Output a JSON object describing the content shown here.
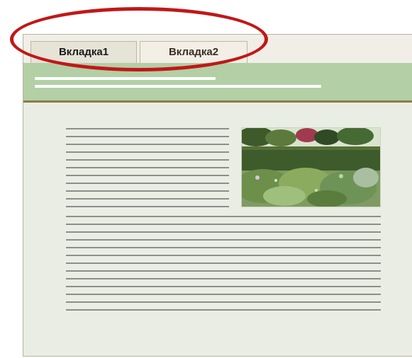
{
  "tabs": [
    {
      "label": "Вкладка1",
      "active": true
    },
    {
      "label": "Вкладка2",
      "active": false
    }
  ],
  "colors": {
    "banner": "#b3cfa6",
    "accent_rule": "#8b7c4a",
    "highlight_ellipse": "#c01818",
    "content_bg": "#e9ede3"
  }
}
